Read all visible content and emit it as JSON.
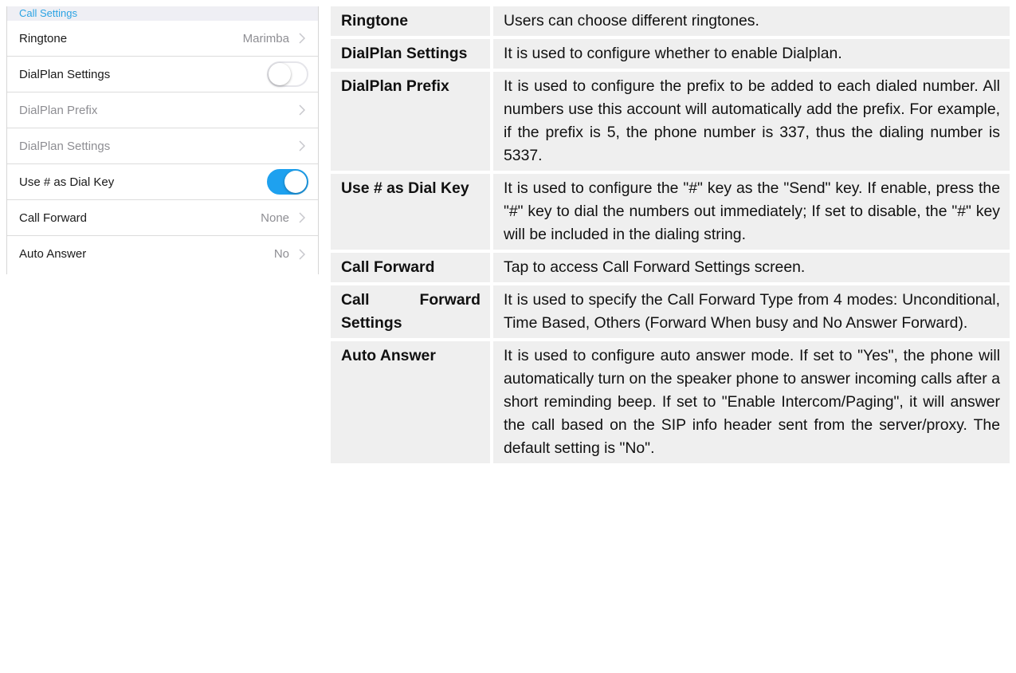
{
  "settings": {
    "section_title": "Call Settings",
    "rows": [
      {
        "label": "Ringtone",
        "value": "Marimba"
      },
      {
        "label": "DialPlan Settings",
        "toggle": "off"
      },
      {
        "label": "DialPlan Prefix",
        "disabled": true
      },
      {
        "label": "DialPlan Settings",
        "disabled": true
      },
      {
        "label": "Use # as Dial Key",
        "toggle": "on"
      },
      {
        "label": "Call Forward",
        "value": "None"
      },
      {
        "label": "Auto Answer",
        "value": "No"
      }
    ],
    "accent_color": "#1ea1ef"
  },
  "table": {
    "rows": [
      {
        "term": "Ringtone",
        "definition": "Users can choose different ringtones."
      },
      {
        "term": "DialPlan Settings",
        "definition": "It is used to configure whether to enable Dialplan."
      },
      {
        "term": "DialPlan Prefix",
        "definition": "It is used to configure the prefix to be added to each dialed number. All numbers use this account will automatically add the prefix. For example, if the prefix is 5, the phone number is 337, thus the dialing number is 5337."
      },
      {
        "term": "Use # as Dial Key",
        "definition": "It is used to configure the \"#\" key as the \"Send\" key. If enable, press the \"#\" key to dial the numbers out immediately; If set to disable, the \"#\" key will be included in the dialing string."
      },
      {
        "term": "Call Forward",
        "definition": "Tap to access Call Forward Settings screen."
      },
      {
        "term": "Call Forward Settings",
        "definition": "It is used to specify the Call Forward Type from 4 modes: Unconditional, Time Based, Others (Forward When busy and No Answer Forward)."
      },
      {
        "term": "Auto Answer",
        "definition": "It is used to configure auto answer mode. If set to \"Yes\", the phone will automatically turn on the speaker phone to answer incoming calls after a short reminding beep. If set to \"Enable Intercom/Paging\", it will answer the call based on the SIP info header sent from the server/proxy. The default setting is \"No\"."
      }
    ]
  }
}
